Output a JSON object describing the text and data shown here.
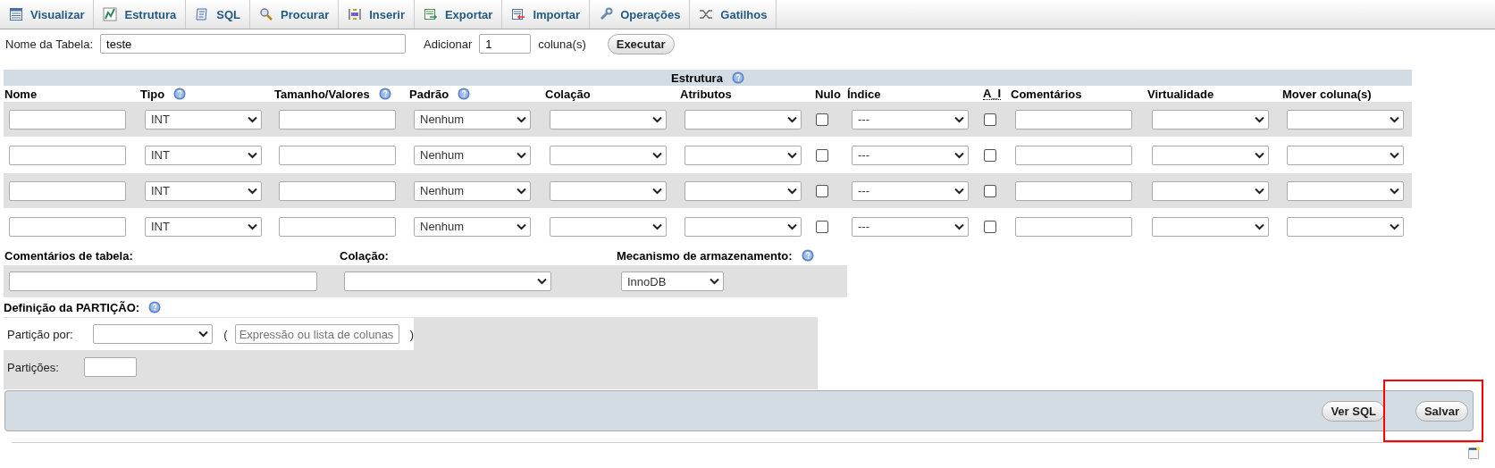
{
  "tabs": [
    {
      "label": "Visualizar"
    },
    {
      "label": "Estrutura"
    },
    {
      "label": "SQL"
    },
    {
      "label": "Procurar"
    },
    {
      "label": "Inserir"
    },
    {
      "label": "Exportar"
    },
    {
      "label": "Importar"
    },
    {
      "label": "Operações"
    },
    {
      "label": "Gatilhos"
    }
  ],
  "table_name": {
    "label": "Nome da Tabela:",
    "value": "teste"
  },
  "add_columns": {
    "label": "Adicionar",
    "value": "1",
    "unit": "coluna(s)",
    "button": "Executar"
  },
  "structure": {
    "title": "Estrutura",
    "help": true,
    "columns": [
      {
        "label": "Nome",
        "kind": "text",
        "help": false
      },
      {
        "label": "Tipo",
        "kind": "select",
        "help": true
      },
      {
        "label": "Tamanho/Valores",
        "kind": "text",
        "help": true
      },
      {
        "label": "Padrão",
        "kind": "select",
        "help": true
      },
      {
        "label": "Colação",
        "kind": "select",
        "help": false
      },
      {
        "label": "Atributos",
        "kind": "select",
        "help": false
      },
      {
        "label": "Nulo",
        "kind": "checkbox",
        "help": false
      },
      {
        "label": "Índice",
        "kind": "select",
        "help": false
      },
      {
        "label": "A_I",
        "kind": "checkbox",
        "help": false,
        "abbr": true
      },
      {
        "label": "Comentários",
        "kind": "text",
        "help": false
      },
      {
        "label": "Virtualidade",
        "kind": "select",
        "help": false
      },
      {
        "label": "Mover coluna(s)",
        "kind": "select",
        "help": false
      }
    ],
    "rows": [
      {
        "cells": [
          {},
          {
            "value": "INT"
          },
          {},
          {
            "value": "Nenhum"
          },
          {},
          {},
          {
            "checked": false
          },
          {
            "value": "---"
          },
          {
            "checked": false
          },
          {},
          {},
          {}
        ]
      },
      {
        "cells": [
          {},
          {
            "value": "INT"
          },
          {},
          {
            "value": "Nenhum"
          },
          {},
          {},
          {
            "checked": false
          },
          {
            "value": "---"
          },
          {
            "checked": false
          },
          {},
          {},
          {}
        ]
      },
      {
        "cells": [
          {},
          {
            "value": "INT"
          },
          {},
          {
            "value": "Nenhum"
          },
          {},
          {},
          {
            "checked": false
          },
          {
            "value": "---"
          },
          {
            "checked": false
          },
          {},
          {},
          {}
        ]
      },
      {
        "cells": [
          {},
          {
            "value": "INT"
          },
          {},
          {
            "value": "Nenhum"
          },
          {},
          {},
          {
            "checked": false
          },
          {
            "value": "---"
          },
          {
            "checked": false
          },
          {},
          {},
          {}
        ]
      }
    ]
  },
  "table_options": {
    "comments_label": "Comentários de tabela:",
    "collation_label": "Colação:",
    "engine_label": "Mecanismo de armazenamento:",
    "engine_help": true,
    "engine": "InnoDB"
  },
  "partition": {
    "title": "Definição da PARTIÇÃO:",
    "help": true,
    "by_label": "Partição por:",
    "open_paren": "(",
    "expression_placeholder": "Expressão ou lista de colunas",
    "close_paren": ")",
    "count_label": "Partições:"
  },
  "footer": {
    "buttons": [
      {
        "label": "Ver SQL",
        "highlighted": false
      },
      {
        "label": "Salvar",
        "highlighted": true
      }
    ]
  }
}
